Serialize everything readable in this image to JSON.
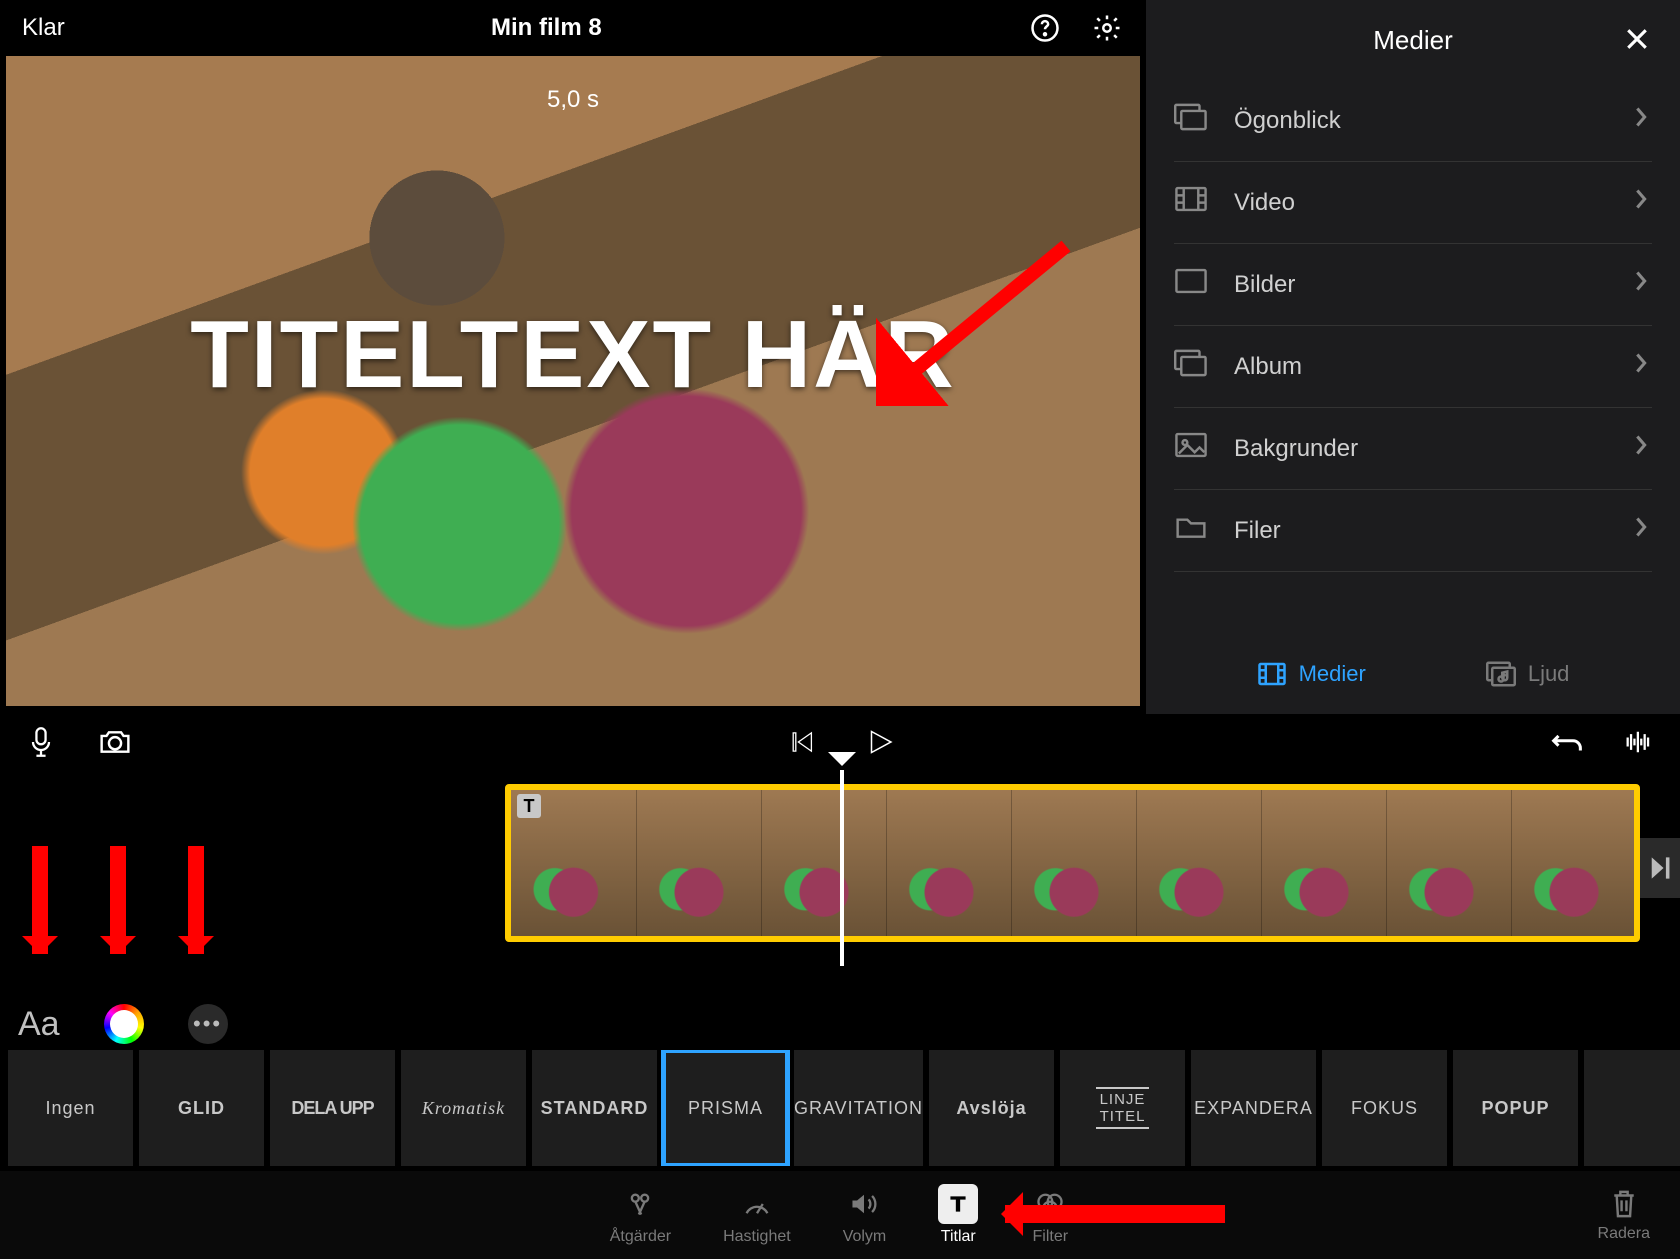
{
  "header": {
    "done": "Klar",
    "title": "Min film 8"
  },
  "preview": {
    "duration": "5,0 s",
    "title_overlay": "TITELTEXT HÄR"
  },
  "media": {
    "title": "Medier",
    "items": [
      {
        "label": "Ögonblick",
        "icon": "moments"
      },
      {
        "label": "Video",
        "icon": "video"
      },
      {
        "label": "Bilder",
        "icon": "images"
      },
      {
        "label": "Album",
        "icon": "album"
      },
      {
        "label": "Bakgrunder",
        "icon": "backgrounds"
      },
      {
        "label": "Filer",
        "icon": "files"
      }
    ],
    "tabs": {
      "media": "Medier",
      "audio": "Ljud"
    }
  },
  "title_styles": [
    {
      "label": "Ingen",
      "variant": "plain"
    },
    {
      "label": "GLID",
      "variant": "bold"
    },
    {
      "label": "DELA UPP",
      "variant": "narrow"
    },
    {
      "label": "Kromatisk",
      "variant": "serif"
    },
    {
      "label": "STANDARD",
      "variant": "bold"
    },
    {
      "label": "PRISMA",
      "variant": "plain",
      "selected": true
    },
    {
      "label": "GRAVITATION",
      "variant": "plain"
    },
    {
      "label": "Avslöja",
      "variant": "bold"
    },
    {
      "label": "LINJE TITEL",
      "variant": "lines"
    },
    {
      "label": "EXPANDERA",
      "variant": "plain"
    },
    {
      "label": "FOKUS",
      "variant": "plain"
    },
    {
      "label": "POPUP",
      "variant": "bold"
    },
    {
      "label": "",
      "variant": "plain"
    }
  ],
  "bottom_tabs": {
    "actions": "Åtgärder",
    "speed": "Hastighet",
    "volume": "Volym",
    "titles": "Titlar",
    "filter": "Filter",
    "delete": "Radera"
  },
  "tools": {
    "font": "Aa"
  }
}
